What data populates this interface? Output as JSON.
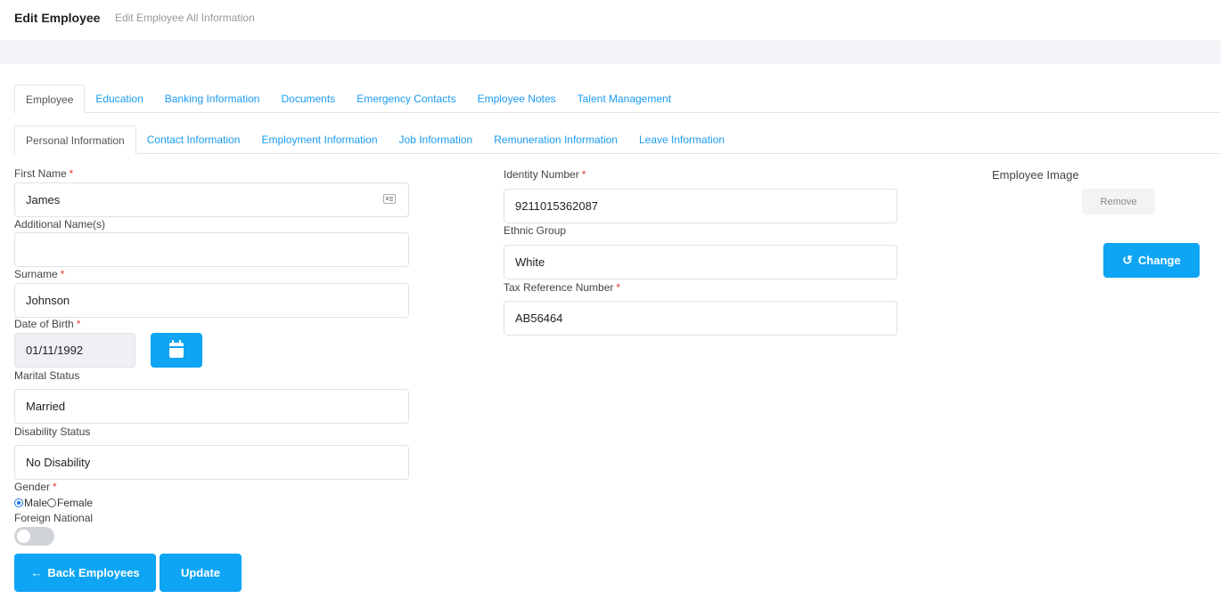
{
  "header": {
    "title": "Edit Employee",
    "subtitle": "Edit Employee All Information"
  },
  "tabs": [
    {
      "label": "Employee",
      "active": true
    },
    {
      "label": "Education",
      "active": false
    },
    {
      "label": "Banking Information",
      "active": false
    },
    {
      "label": "Documents",
      "active": false
    },
    {
      "label": "Emergency Contacts",
      "active": false
    },
    {
      "label": "Employee Notes",
      "active": false
    },
    {
      "label": "Talent Management",
      "active": false
    }
  ],
  "subtabs": [
    {
      "label": "Personal Information",
      "active": true
    },
    {
      "label": "Contact Information",
      "active": false
    },
    {
      "label": "Employment Information",
      "active": false
    },
    {
      "label": "Job Information",
      "active": false
    },
    {
      "label": "Remuneration Information",
      "active": false
    },
    {
      "label": "Leave Information",
      "active": false
    }
  ],
  "form": {
    "first_name": {
      "label": "First Name",
      "required": "*",
      "value": "James"
    },
    "additional_names": {
      "label": "Additional Name(s)",
      "value": ""
    },
    "surname": {
      "label": "Surname",
      "required": "*",
      "value": "Johnson"
    },
    "date_of_birth": {
      "label": "Date of Birth",
      "required": "*",
      "value": "01/11/1992"
    },
    "marital_status": {
      "label": "Marital Status",
      "value": "Married"
    },
    "disability_status": {
      "label": "Disability Status",
      "value": "No Disability"
    },
    "gender": {
      "label": "Gender",
      "required": "*",
      "options": [
        "Male",
        "Female"
      ],
      "selected": "Male"
    },
    "foreign_national": {
      "label": "Foreign National",
      "value": false
    },
    "identity_number": {
      "label": "Identity Number",
      "required": "*",
      "value": "9211015362087"
    },
    "ethnic_group": {
      "label": "Ethnic Group",
      "value": "White"
    },
    "tax_reference": {
      "label": "Tax Reference Number",
      "required": "*",
      "value": "AB56464"
    }
  },
  "image_section": {
    "label": "Employee Image",
    "remove_label": "Remove",
    "change_label": "Change"
  },
  "actions": {
    "back_label": "Back Employees",
    "update_label": "Update"
  },
  "colors": {
    "accent": "#0ea5f5",
    "link": "#1a9bf0",
    "required": "#e53935"
  },
  "icons": {
    "id_card": "id-card-icon",
    "calendar": "calendar-icon",
    "arrow_left": "arrow-left-icon",
    "undo": "undo-icon"
  }
}
